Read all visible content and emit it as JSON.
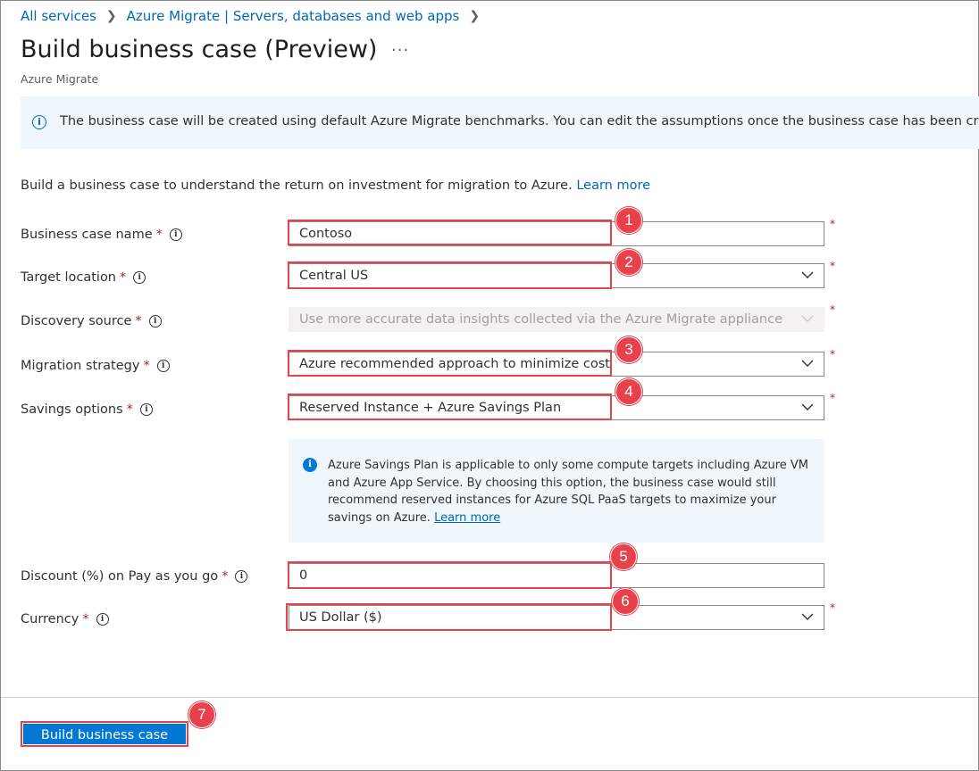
{
  "breadcrumb": {
    "items": [
      "All services",
      "Azure Migrate | Servers, databases and web apps"
    ]
  },
  "header": {
    "title": "Build business case (Preview)",
    "more": "···",
    "subtitle": "Azure Migrate"
  },
  "banner": {
    "text": "The business case will be created using default Azure Migrate benchmarks. You can edit the assumptions once the business case has been created."
  },
  "intro": {
    "text": "Build a business case to understand the return on investment for migration to Azure.",
    "link": "Learn more"
  },
  "form": {
    "business_case_name": {
      "label": "Business case name",
      "value": "Contoso"
    },
    "target_location": {
      "label": "Target location",
      "value": "Central US"
    },
    "discovery_source": {
      "label": "Discovery source",
      "value": "Use more accurate data insights collected via the Azure Migrate appliance"
    },
    "migration_strategy": {
      "label": "Migration strategy",
      "value": "Azure recommended approach to minimize cost"
    },
    "savings_options": {
      "label": "Savings options",
      "value": "Reserved Instance + Azure Savings Plan"
    },
    "savings_info": {
      "text": "Azure Savings Plan is applicable to only some compute targets including Azure VM and Azure App Service. By choosing this option, the business case would still recommend reserved instances for Azure SQL PaaS targets to maximize your savings on Azure.",
      "link": "Learn more"
    },
    "discount": {
      "label": "Discount (%) on Pay as you go",
      "value": "0"
    },
    "currency": {
      "label": "Currency",
      "value": "US Dollar ($)"
    },
    "required_mark": "*",
    "info_glyph": "i"
  },
  "callouts": [
    "1",
    "2",
    "3",
    "4",
    "5",
    "6",
    "7"
  ],
  "footer": {
    "button_label": "Build business case"
  },
  "colors": {
    "accent": "#0078d4",
    "link": "#0067b8",
    "highlight": "#e8414b",
    "info_bg": "#eff6fc"
  }
}
